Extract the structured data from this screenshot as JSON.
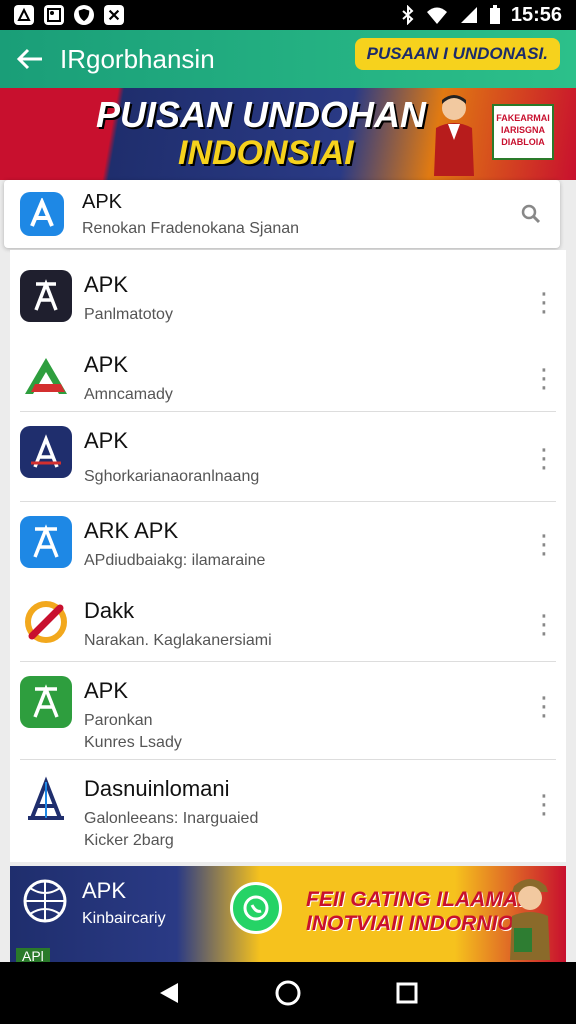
{
  "status_bar": {
    "time": "15:56",
    "left_icons": [
      "notification-icon",
      "image-icon",
      "shield-icon",
      "check-icon"
    ],
    "right_icons": [
      "bluetooth-icon",
      "wifi-icon",
      "signal-icon",
      "battery-icon"
    ]
  },
  "app_bar": {
    "title": "IRgorbhansin",
    "badge": "PUSAAN I UNDONASI."
  },
  "hero": {
    "line1": "PUISAN UNDOHAN",
    "line2": "INDONSIAI",
    "side_text": "FAKEARMAI IARISGNA DIABLOIA"
  },
  "search": {
    "title": "APK",
    "subtitle": "Renokan Fradenokana Sjanan"
  },
  "apps": [
    {
      "title": "APK",
      "subtitle": "Panlmatotoy",
      "subtitle2": "",
      "icon": "apk-dark-icon"
    },
    {
      "title": "APK",
      "subtitle": "Amncamady",
      "subtitle2": "",
      "icon": "apk-green-red-icon"
    },
    {
      "title": "APK",
      "subtitle": "Sghorkarianaoranlnaang",
      "subtitle2": "",
      "icon": "apk-navy-icon"
    },
    {
      "title": "ARK APK",
      "subtitle": "APdiudbaiakg: ilamaraine",
      "subtitle2": "",
      "icon": "apk-blue-icon"
    },
    {
      "title": "Dakk",
      "subtitle": "Narakan. Kaglakanersiami",
      "subtitle2": "",
      "icon": "dakk-icon"
    },
    {
      "title": "APK",
      "subtitle": "Paronkan",
      "subtitle2": "Kunres Lsady",
      "icon": "apk-green-icon"
    },
    {
      "title": "Dasnuinlomani",
      "subtitle": "Galonleeans: Inarguaied",
      "subtitle2": "Kicker 2barg",
      "icon": "apk-outline-icon"
    }
  ],
  "bottom_banner": {
    "title": "APK",
    "subtitle": "Kinbaircariy",
    "tag": "APl",
    "promo_line1": "FEII GATING ILAAMAI",
    "promo_line2": "INOTVIAII INDORNIO"
  },
  "colors": {
    "app_bar": "#1a9e78",
    "accent_yellow": "#f6d21d",
    "brand_red": "#c8102e",
    "brand_blue": "#1e88e5"
  }
}
